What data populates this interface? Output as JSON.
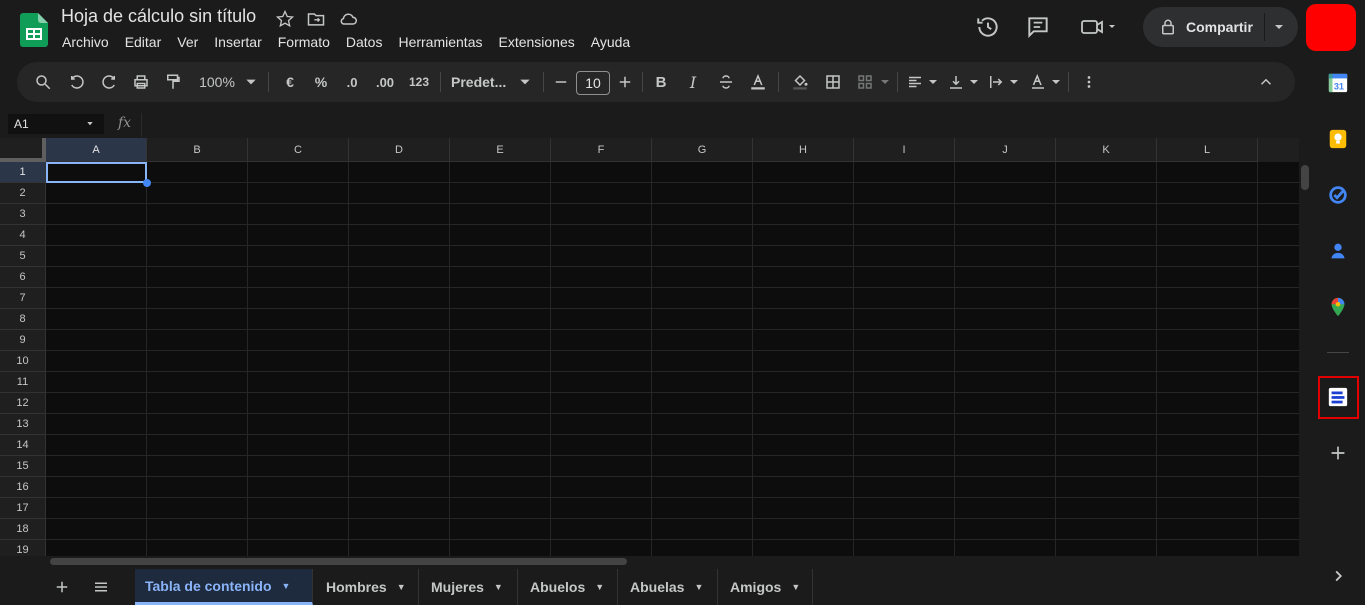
{
  "doc": {
    "title": "Hoja de cálculo sin título"
  },
  "menu": [
    "Archivo",
    "Editar",
    "Ver",
    "Insertar",
    "Formato",
    "Datos",
    "Herramientas",
    "Extensiones",
    "Ayuda"
  ],
  "share": {
    "label": "Compartir"
  },
  "toolbar": {
    "zoom": "100%",
    "currency": "€",
    "percent": "%",
    "dec_decrease": ".0",
    "dec_increase": ".00",
    "number_format": "123",
    "font": "Predet...",
    "font_size": "10",
    "bold": "B",
    "italic": "I"
  },
  "formula_bar": {
    "cell_ref": "A1",
    "fx": "fx"
  },
  "columns": [
    "A",
    "B",
    "C",
    "D",
    "E",
    "F",
    "G",
    "H",
    "I",
    "J",
    "K",
    "L"
  ],
  "rows": [
    "1",
    "2",
    "3",
    "4",
    "5",
    "6",
    "7",
    "8",
    "9",
    "10",
    "11",
    "12",
    "13",
    "14",
    "15",
    "16",
    "17",
    "18",
    "19"
  ],
  "sheets": [
    "Tabla de contenido",
    "Hombres",
    "Mujeres",
    "Abuelos",
    "Abuelas",
    "Amigos"
  ],
  "side_panel": {
    "calendar_day": "31"
  },
  "colors": {
    "accent": "#8ab4f8",
    "sheets_green": "#0f9d58",
    "avatar": "#ff0000",
    "highlight": "#e00000"
  }
}
